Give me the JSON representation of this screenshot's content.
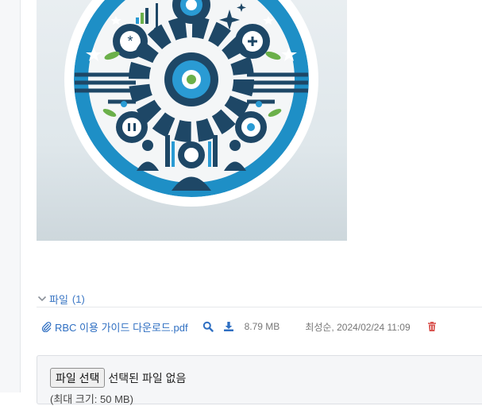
{
  "files": {
    "section_title": "파일",
    "count": "(1)",
    "items": [
      {
        "name": "RBC 이용 가이드 다운로드.pdf",
        "size": "8.79 MB",
        "meta": "최성순, 2024/02/24 11:09"
      }
    ]
  },
  "upload": {
    "choose_label": "파일 선택",
    "no_file_text": "선택된 파일 없음",
    "note": "(최대 크기: 50 MB)"
  },
  "colors": {
    "link": "#2f6fc2",
    "delete": "#d9534f",
    "emblem_dark": "#1e4766",
    "emblem_blue": "#2a9bd4"
  },
  "icons": {
    "chevron": "chevron-down-icon",
    "clip": "paperclip-icon",
    "preview": "magnifier-icon",
    "download": "download-icon",
    "delete": "trash-icon"
  }
}
